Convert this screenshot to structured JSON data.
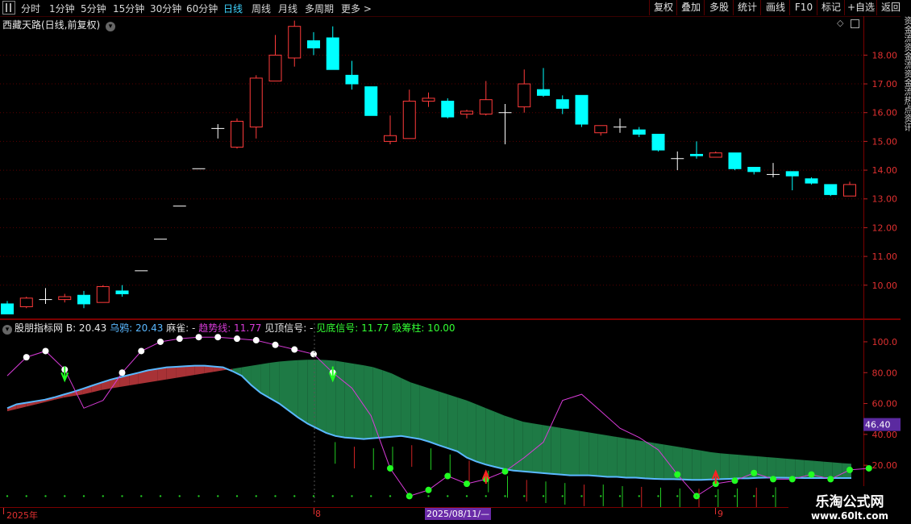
{
  "toolbar": {
    "left_items": [
      {
        "label": "分时",
        "active": false
      },
      {
        "label": "1分钟",
        "active": false
      },
      {
        "label": "5分钟",
        "active": false
      },
      {
        "label": "15分钟",
        "active": false
      },
      {
        "label": "30分钟",
        "active": false
      },
      {
        "label": "60分钟",
        "active": false
      },
      {
        "label": "日线",
        "active": true
      },
      {
        "label": "周线",
        "active": false
      },
      {
        "label": "月线",
        "active": false
      },
      {
        "label": "多周期",
        "active": false
      },
      {
        "label": "更多",
        "active": false
      }
    ],
    "right_items": [
      "复权",
      "叠加",
      "多股",
      "统计",
      "画线",
      "F10",
      "标记",
      "+自选",
      "返回"
    ]
  },
  "main_chart": {
    "title": "西藏天路(日线,前复权)",
    "y_ticks": [
      "18.00",
      "17.00",
      "16.00",
      "15.00",
      "14.00",
      "13.00",
      "12.00",
      "11.00",
      "10.00"
    ],
    "colors": {
      "up": "#ff3b3b",
      "down": "#00ffff",
      "flat": "#ffffff"
    }
  },
  "indicator": {
    "name": "股朋指标网",
    "b_label": "B: 20.43",
    "wuya_label": "乌鸦: 20.43",
    "maque_label": "麻雀: -",
    "trend_label": "趋势线: 11.77",
    "top_signal_label": "见顶信号: -",
    "bottom_signal_label": "见底信号: 11.77",
    "accum_label": "吸筹柱: 10.00",
    "y_ticks": [
      "100.0",
      "80.00",
      "60.00",
      "40.00",
      "20.00"
    ],
    "cursor_value": "46.40"
  },
  "time_axis": {
    "labels": [
      "2025年",
      "8",
      "9"
    ],
    "cursor_date": "2025/08/11/—"
  },
  "right_strip_text": "资金流资金流资金流热点资讯",
  "watermark": {
    "line1": "乐淘公式网",
    "line2": "www.60lt.com"
  },
  "chart_data": [
    {
      "type": "candlestick",
      "title": "西藏天路(日线,前复权)",
      "ylim": [
        8.9,
        19.3
      ],
      "candles": [
        {
          "o": 9.35,
          "h": 9.45,
          "l": 9.05,
          "c": 9.0
        },
        {
          "o": 9.25,
          "h": 9.6,
          "l": 9.2,
          "c": 9.55
        },
        {
          "o": 9.5,
          "h": 9.9,
          "l": 9.35,
          "c": 9.5
        },
        {
          "o": 9.5,
          "h": 9.7,
          "l": 9.4,
          "c": 9.6
        },
        {
          "o": 9.65,
          "h": 9.8,
          "l": 9.2,
          "c": 9.35
        },
        {
          "o": 9.4,
          "h": 10.0,
          "l": 9.4,
          "c": 9.95
        },
        {
          "o": 9.8,
          "h": 10.0,
          "l": 9.6,
          "c": 9.7
        },
        {
          "o": 10.5,
          "h": 10.5,
          "l": 10.5,
          "c": 10.5
        },
        {
          "o": 11.6,
          "h": 11.6,
          "l": 11.6,
          "c": 11.6
        },
        {
          "o": 12.75,
          "h": 12.75,
          "l": 12.75,
          "c": 12.75
        },
        {
          "o": 14.05,
          "h": 14.05,
          "l": 14.05,
          "c": 14.05
        },
        {
          "o": 15.45,
          "h": 15.6,
          "l": 15.1,
          "c": 15.45
        },
        {
          "o": 14.8,
          "h": 15.8,
          "l": 14.75,
          "c": 15.7
        },
        {
          "o": 15.5,
          "h": 17.3,
          "l": 15.1,
          "c": 17.2
        },
        {
          "o": 17.1,
          "h": 18.7,
          "l": 17.1,
          "c": 18.0
        },
        {
          "o": 17.9,
          "h": 19.2,
          "l": 17.6,
          "c": 19.0
        },
        {
          "o": 18.5,
          "h": 18.8,
          "l": 18.0,
          "c": 18.25
        },
        {
          "o": 18.6,
          "h": 19.0,
          "l": 17.5,
          "c": 17.5
        },
        {
          "o": 17.3,
          "h": 17.8,
          "l": 16.8,
          "c": 17.0
        },
        {
          "o": 16.9,
          "h": 16.9,
          "l": 15.9,
          "c": 15.9
        },
        {
          "o": 15.0,
          "h": 15.9,
          "l": 14.9,
          "c": 15.2
        },
        {
          "o": 15.1,
          "h": 16.8,
          "l": 15.1,
          "c": 16.4
        },
        {
          "o": 16.4,
          "h": 16.7,
          "l": 16.2,
          "c": 16.5
        },
        {
          "o": 16.4,
          "h": 16.5,
          "l": 15.8,
          "c": 15.85
        },
        {
          "o": 15.95,
          "h": 16.1,
          "l": 15.8,
          "c": 16.05
        },
        {
          "o": 15.95,
          "h": 17.1,
          "l": 15.9,
          "c": 16.45
        },
        {
          "o": 16.0,
          "h": 16.3,
          "l": 14.9,
          "c": 16.0
        },
        {
          "o": 16.2,
          "h": 17.5,
          "l": 16.0,
          "c": 17.0
        },
        {
          "o": 16.8,
          "h": 17.55,
          "l": 16.55,
          "c": 16.6
        },
        {
          "o": 16.45,
          "h": 16.6,
          "l": 15.95,
          "c": 16.15
        },
        {
          "o": 16.6,
          "h": 16.6,
          "l": 15.5,
          "c": 15.6
        },
        {
          "o": 15.3,
          "h": 15.55,
          "l": 15.2,
          "c": 15.55
        },
        {
          "o": 15.5,
          "h": 15.8,
          "l": 15.3,
          "c": 15.5
        },
        {
          "o": 15.4,
          "h": 15.5,
          "l": 15.15,
          "c": 15.25
        },
        {
          "o": 15.25,
          "h": 15.25,
          "l": 14.65,
          "c": 14.7
        },
        {
          "o": 14.4,
          "h": 14.65,
          "l": 14.0,
          "c": 14.4
        },
        {
          "o": 14.55,
          "h": 15.0,
          "l": 14.4,
          "c": 14.5
        },
        {
          "o": 14.45,
          "h": 14.65,
          "l": 14.45,
          "c": 14.6
        },
        {
          "o": 14.6,
          "h": 14.6,
          "l": 14.0,
          "c": 14.05
        },
        {
          "o": 14.1,
          "h": 14.1,
          "l": 13.85,
          "c": 13.95
        },
        {
          "o": 13.85,
          "h": 14.25,
          "l": 13.75,
          "c": 13.85
        },
        {
          "o": 13.95,
          "h": 13.95,
          "l": 13.3,
          "c": 13.8
        },
        {
          "o": 13.7,
          "h": 13.75,
          "l": 13.5,
          "c": 13.55
        },
        {
          "o": 13.5,
          "h": 13.5,
          "l": 13.1,
          "c": 13.15
        },
        {
          "o": 13.1,
          "h": 13.6,
          "l": 13.1,
          "c": 13.5
        }
      ]
    },
    {
      "type": "line",
      "title": "股朋指标网",
      "ylim": [
        -5,
        112
      ],
      "series": [
        {
          "name": "乌鸦",
          "color": "#5ab8ff",
          "values": [
            57,
            59.5,
            60.5,
            61.5,
            62.5,
            64,
            65.8,
            67.5,
            69.5,
            71.5,
            73.5,
            75.5,
            77,
            78.5,
            80,
            81.5,
            82.5,
            83.5,
            83.8,
            84.2,
            84.5,
            84.5,
            84,
            83.5,
            81,
            78,
            72,
            67,
            63.5,
            60,
            55.5,
            51,
            47,
            44,
            41,
            39,
            38,
            37.5,
            37,
            37.5,
            38,
            38.5,
            39,
            38,
            37,
            35.2,
            33,
            31,
            29,
            25,
            22.5,
            20.5,
            19,
            17.5,
            16.5,
            16,
            15.5,
            15,
            14.5,
            14,
            13.5,
            13.5,
            13.5,
            13,
            12.5,
            12.5,
            12,
            12,
            11.5,
            11.2,
            11,
            11,
            10.8,
            10.5,
            10.5,
            10.8,
            11,
            11.2,
            11.5,
            11.5,
            11.8,
            12,
            12,
            11.9,
            11.8,
            11.7,
            11.7,
            11.7,
            11.7,
            11.7,
            11.7
          ]
        },
        {
          "name": "麻雀",
          "color": "#d83bd8",
          "values": [
            78,
            90,
            94,
            82,
            57,
            62,
            80,
            94,
            100,
            102,
            103,
            103,
            102,
            101,
            98,
            95,
            92,
            80,
            70,
            52,
            18,
            0,
            4,
            13,
            8,
            11,
            16,
            25,
            35,
            62,
            66,
            55,
            44,
            38,
            30,
            14,
            0,
            8,
            10,
            15,
            11,
            11,
            14,
            11,
            17,
            18
          ]
        },
        {
          "name": "趋势线",
          "color": "#2a8a5a",
          "values": [
            55,
            58,
            61,
            64,
            66,
            69,
            71,
            73,
            75,
            77,
            79,
            81,
            83,
            85,
            87,
            88,
            88.5,
            88,
            86,
            84,
            80,
            74,
            70,
            66,
            62,
            57,
            52,
            48,
            46,
            44,
            42,
            40,
            38,
            36,
            34,
            32,
            30,
            28,
            27,
            26,
            25,
            24,
            23,
            22,
            21,
            20.5
          ]
        }
      ]
    }
  ]
}
